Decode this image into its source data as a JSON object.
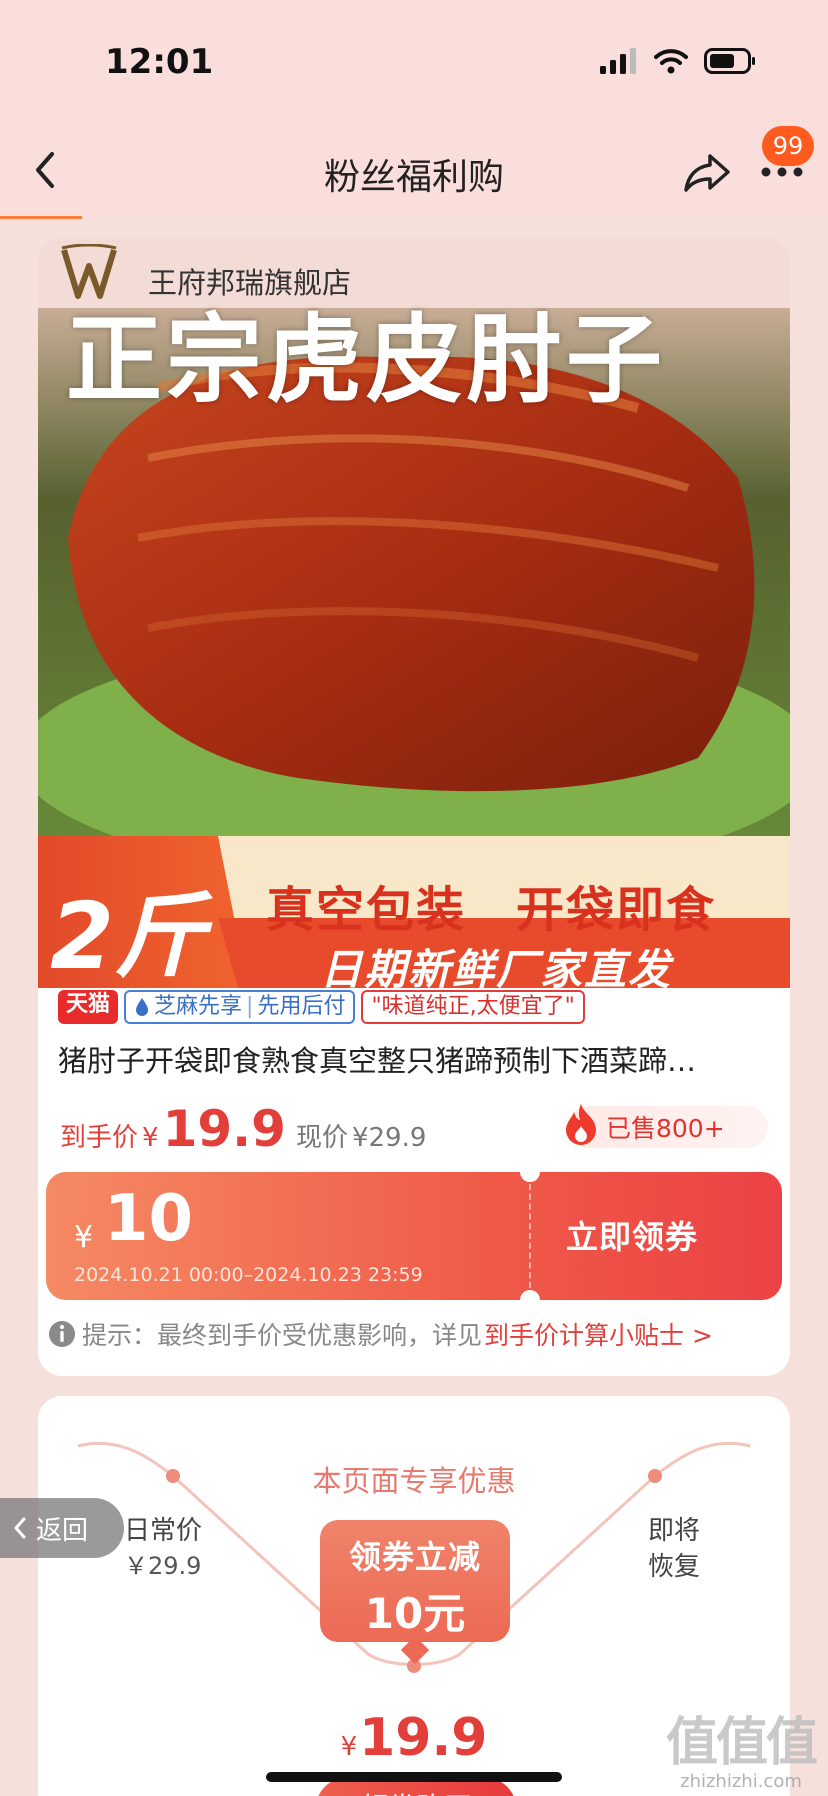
{
  "status": {
    "time": "12:01"
  },
  "nav": {
    "title": "粉丝福利购",
    "badge": "99"
  },
  "store": {
    "name": "王府邦瑞旗舰店"
  },
  "image": {
    "headline": "正宗虎皮肘子",
    "weight": "2斤",
    "line1": "真空包装　开袋即食",
    "line2": "日期新鲜厂家直发"
  },
  "tags": {
    "tmall": "天猫",
    "sesame": "芝麻先享",
    "sesame_sep": "|",
    "sesame_pay": "先用后付",
    "quote": "\"味道纯正,太便宜了\""
  },
  "product": {
    "title": "猪肘子开袋即食熟食真空整只猪蹄预制下酒菜蹄…",
    "final_label": "到手价",
    "currency": "¥",
    "final_price": "19.9",
    "now_label": "现价",
    "now_price": "¥29.9",
    "sold": "已售800+"
  },
  "coupon": {
    "currency": "¥",
    "amount": "10",
    "valid": "2024.10.21 00:00–2024.10.23 23:59",
    "button": "立即领券"
  },
  "tip": {
    "text": "提示：最终到手价受优惠影响，详见",
    "link": "到手价计算小贴士 >"
  },
  "promo": {
    "title": "本页面专享优惠",
    "daily_label": "日常价",
    "daily_price": "￥29.9",
    "resume_line1": "即将",
    "resume_line2": "恢复",
    "box_line1": "领券立减",
    "box_line2": "10元",
    "final_currency": "¥",
    "final_price": "19.9",
    "claim": "领券购买"
  },
  "floating": {
    "return": "返回"
  },
  "watermark": {
    "glyphs": "值值值",
    "url": "zhizhizhi.com"
  },
  "colors": {
    "accent": "#e23f3a",
    "badge": "#ff5b1f",
    "header_bg": "#f9dedb"
  }
}
